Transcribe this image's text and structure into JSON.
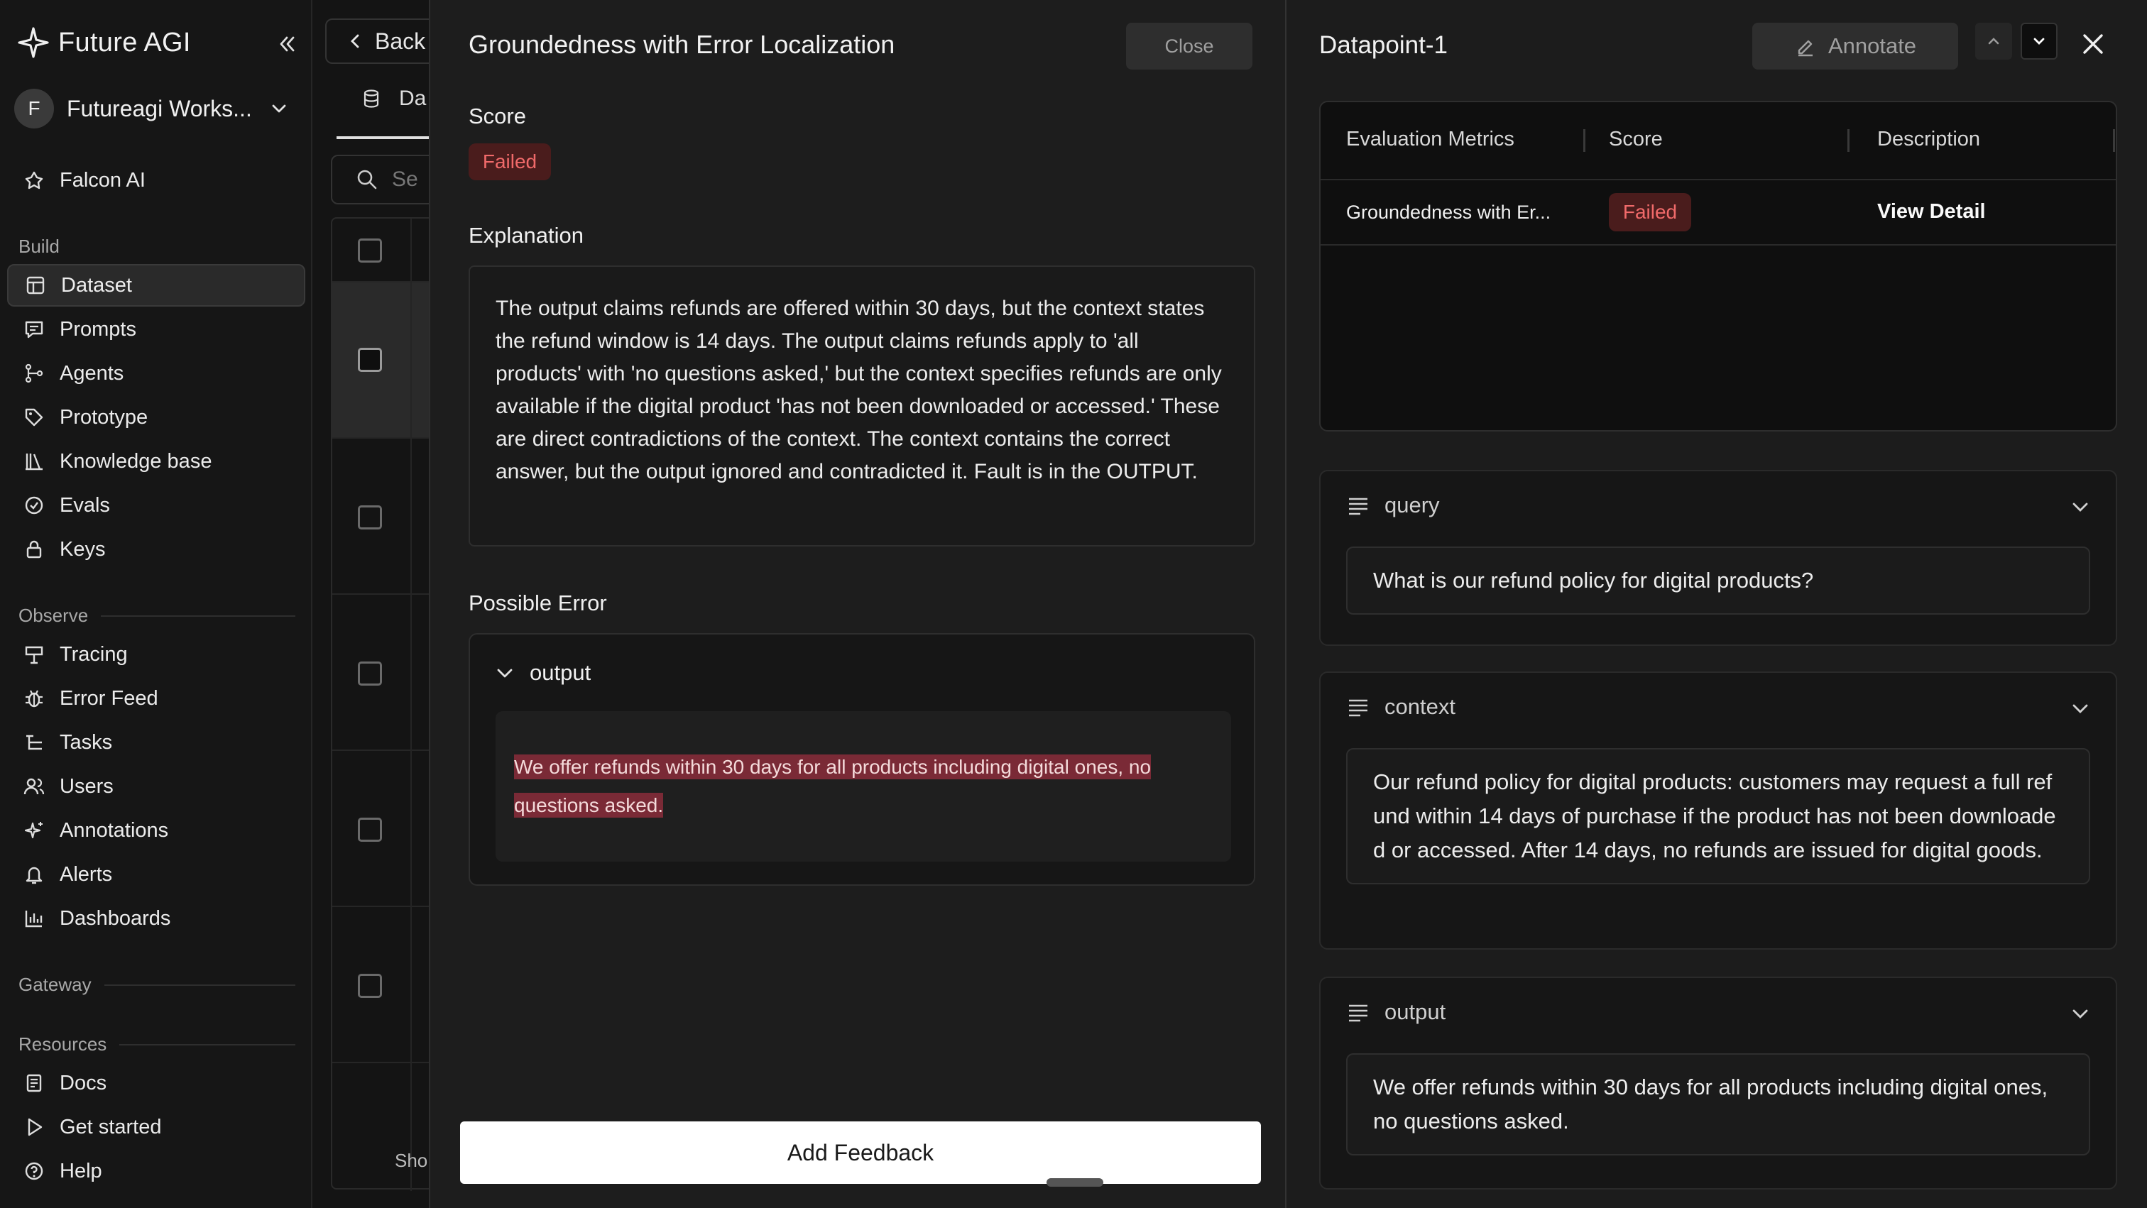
{
  "sidebar": {
    "brand": "Future AGI",
    "workspace": {
      "initial": "F",
      "name": "Futureagi Works..."
    },
    "top_items": [
      {
        "label": "Falcon AI",
        "icon": "falcon-icon"
      }
    ],
    "sections": {
      "build": "Build",
      "observe": "Observe",
      "gateway": "Gateway",
      "resources": "Resources"
    },
    "build_items": [
      {
        "label": "Dataset",
        "icon": "table-icon",
        "active": true
      },
      {
        "label": "Prompts",
        "icon": "chat-icon"
      },
      {
        "label": "Agents",
        "icon": "flow-icon"
      },
      {
        "label": "Prototype",
        "icon": "tag-icon"
      },
      {
        "label": "Knowledge base",
        "icon": "books-icon"
      },
      {
        "label": "Evals",
        "icon": "check-circle-icon"
      },
      {
        "label": "Keys",
        "icon": "lock-icon"
      }
    ],
    "observe_items": [
      {
        "label": "Tracing",
        "icon": "signpost-icon"
      },
      {
        "label": "Error Feed",
        "icon": "bug-icon"
      },
      {
        "label": "Tasks",
        "icon": "tasks-icon"
      },
      {
        "label": "Users",
        "icon": "users-icon"
      },
      {
        "label": "Annotations",
        "icon": "sparkle-icon"
      },
      {
        "label": "Alerts",
        "icon": "bell-icon"
      },
      {
        "label": "Dashboards",
        "icon": "chart-icon"
      }
    ],
    "resource_items": [
      {
        "label": "Docs",
        "icon": "doc-icon"
      },
      {
        "label": "Get started",
        "icon": "play-icon"
      },
      {
        "label": "Help",
        "icon": "help-icon"
      }
    ]
  },
  "background": {
    "back_label": "Back",
    "tab_label": "Da",
    "search_placeholder": "Se",
    "footer_text": "Sho"
  },
  "eval_panel": {
    "title": "Groundedness with Error Localization",
    "close_label": "Close",
    "score_label": "Score",
    "score_value": "Failed",
    "explanation_label": "Explanation",
    "explanation": "The output claims refunds are offered within 30 days, but the context states the refund window is 14 days. The output claims refunds apply to 'all products' with 'no questions asked,' but the context specifies refunds are only available if the digital product 'has not been downloaded or accessed.' These are direct contradictions of the context. The context contains the correct answer, but the output ignored and contradicted it. Fault is in the OUTPUT.",
    "possible_error_label": "Possible Error",
    "error_field": "output",
    "error_line_1": "We offer refunds within 30 days for all products including digital ones, no",
    "error_line_2": "questions asked.",
    "add_feedback_label": "Add Feedback"
  },
  "datapoint_panel": {
    "title": "Datapoint-1",
    "annotate_label": "Annotate",
    "metrics_table": {
      "headers": [
        "Evaluation Metrics",
        "Score",
        "Description"
      ],
      "rows": [
        {
          "metric": "Groundedness with Er...",
          "score": "Failed",
          "description": "View Detail"
        }
      ]
    },
    "fields": [
      {
        "name": "query",
        "value": "What is our refund policy for digital products?"
      },
      {
        "name": "context",
        "value": "Our refund policy for digital products: customers may request a full refund within 14 days of purchase if the product has not been downloaded or accessed. After 14 days, no refunds are issued for digital goods."
      },
      {
        "name": "output",
        "value": "We offer refunds within 30 days for all products including digital ones, no questions asked."
      }
    ]
  },
  "colors": {
    "failed_bg": "#4a1c1c",
    "failed_text": "#f06a6a",
    "highlight": "#7a2a36"
  }
}
